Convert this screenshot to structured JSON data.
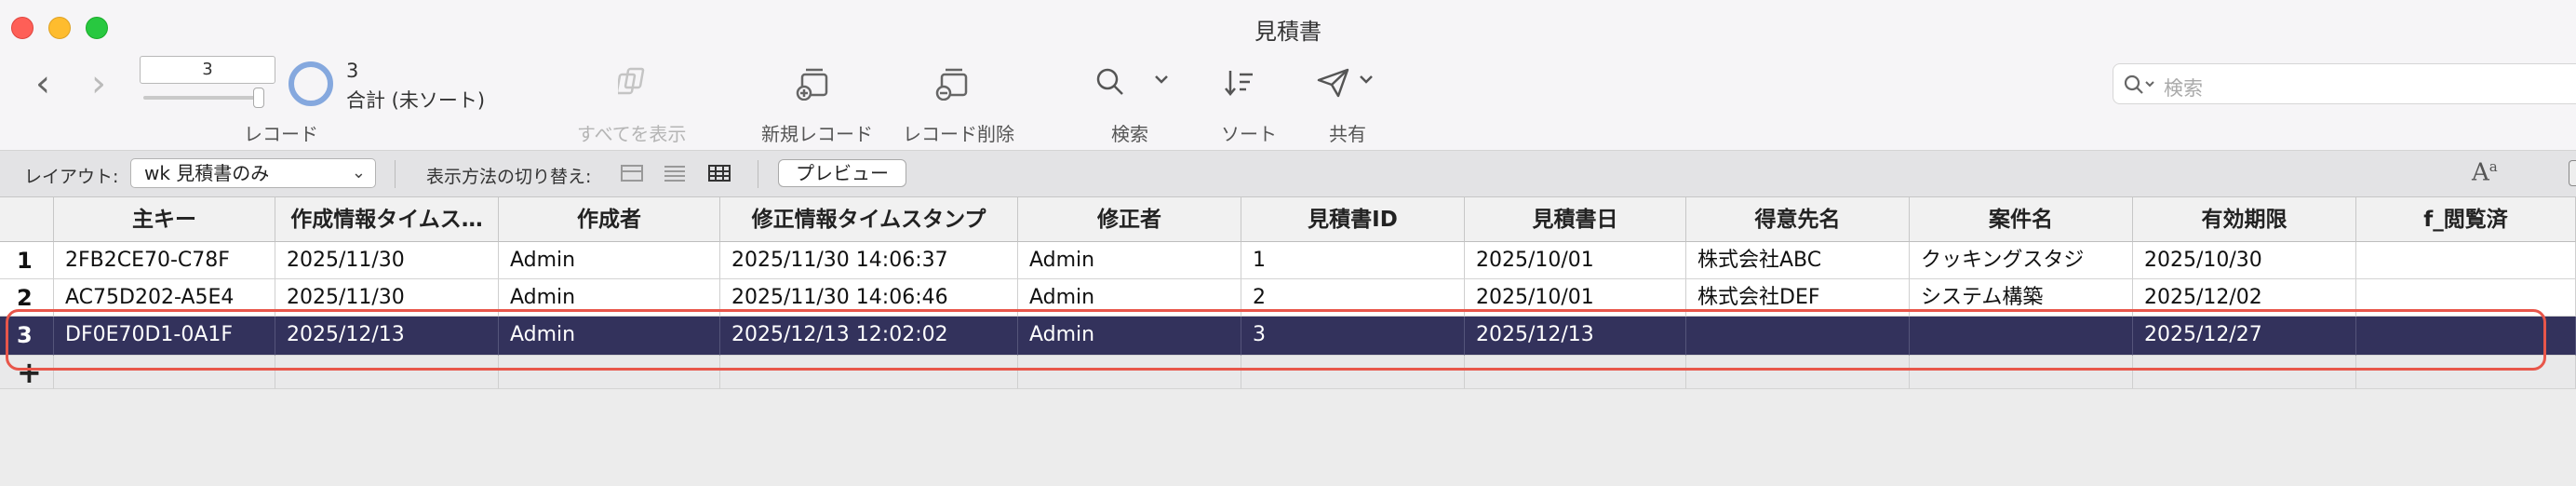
{
  "window": {
    "title": "見積書"
  },
  "toolbar": {
    "record_current": "3",
    "record_count": "3",
    "record_count_label": "合計 (未ソート)",
    "record_label": "レコード",
    "show_all_label": "すべてを表示",
    "new_record_label": "新規レコード",
    "delete_record_label": "レコード削除",
    "find_label": "検索",
    "sort_label": "ソート",
    "share_label": "共有",
    "search_placeholder": "検索"
  },
  "layoutbar": {
    "layout_label": "レイアウト:",
    "layout_value": "wk 見積書のみ",
    "view_switch_label": "表示方法の切り替え:",
    "preview_label": "プレビュー"
  },
  "table": {
    "columns": [
      "主キー",
      "作成情報タイムス…",
      "作成者",
      "修正情報タイムスタンプ",
      "修正者",
      "見積書ID",
      "見積書日",
      "得意先名",
      "案件名",
      "有効期限",
      "f_閲覧済"
    ],
    "rows": [
      {
        "num": "1",
        "cells": [
          "2FB2CE70-C78F",
          "2025/11/30",
          "Admin",
          "2025/11/30 14:06:37",
          "Admin",
          "1",
          "2025/10/01",
          "株式会社ABC",
          "クッキングスタジ",
          "2025/10/30",
          ""
        ]
      },
      {
        "num": "2",
        "cells": [
          "AC75D202-A5E4",
          "2025/11/30",
          "Admin",
          "2025/11/30 14:06:46",
          "Admin",
          "2",
          "2025/10/01",
          "株式会社DEF",
          "システム構築",
          "2025/12/02",
          ""
        ]
      },
      {
        "num": "3",
        "cells": [
          "DF0E70D1-0A1F",
          "2025/12/13",
          "Admin",
          "2025/12/13 12:02:02",
          "Admin",
          "3",
          "2025/12/13",
          "",
          "",
          "2025/12/27",
          ""
        ]
      }
    ],
    "add_row_symbol": "+",
    "selected_row": 3
  },
  "colors": {
    "selected_row_bg": "#33325c",
    "highlight_outline": "#e8564a",
    "record_pie": "#85a8de"
  }
}
